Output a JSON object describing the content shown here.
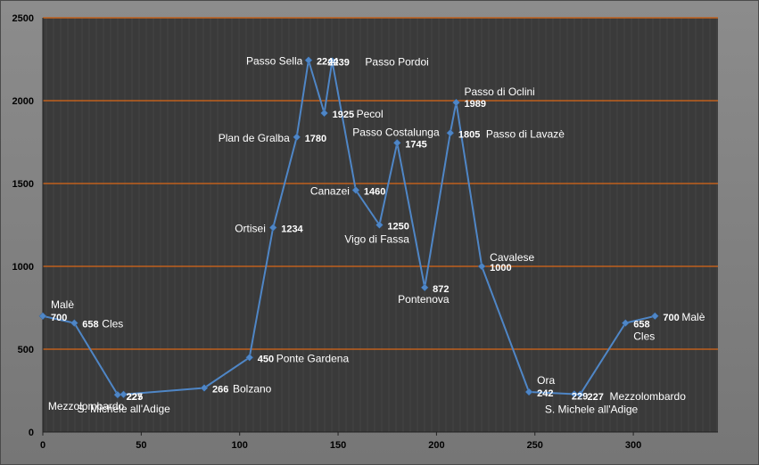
{
  "chart_data": {
    "type": "line",
    "title": "",
    "xlabel": "",
    "ylabel": "",
    "xlim": [
      0,
      343
    ],
    "ylim": [
      0,
      2500
    ],
    "x_ticks": [
      0,
      50,
      100,
      150,
      200,
      250,
      300
    ],
    "y_ticks": [
      0,
      500,
      1000,
      1500,
      2000,
      2500
    ],
    "grid": "horizontal",
    "legend": "none",
    "colors": {
      "background": "#3a3a3a",
      "gridline": "#c0601c",
      "series": "#4f86c6",
      "labels": "#ffffff"
    },
    "series": [
      {
        "points": [
          {
            "x": 0,
            "y": 700,
            "value": "700",
            "name": "Malè"
          },
          {
            "x": 16,
            "y": 658,
            "value": "658",
            "name": "Cles"
          },
          {
            "x": 38,
            "y": 225,
            "value": "225",
            "name": "Mezzolombardo"
          },
          {
            "x": 41,
            "y": 227,
            "value": "227",
            "name": "S. Michele all'Adige"
          },
          {
            "x": 82,
            "y": 266,
            "value": "266",
            "name": "Bolzano"
          },
          {
            "x": 105,
            "y": 450,
            "value": "450",
            "name": "Ponte Gardena"
          },
          {
            "x": 117,
            "y": 1234,
            "value": "1234",
            "name": "Ortisei"
          },
          {
            "x": 129,
            "y": 1780,
            "value": "1780",
            "name": "Plan de Gralba"
          },
          {
            "x": 135,
            "y": 2244,
            "value": "2244",
            "name": "Passo Sella"
          },
          {
            "x": 143,
            "y": 1925,
            "value": "1925",
            "name": "Pecol"
          },
          {
            "x": 147,
            "y": 2239,
            "value": "2239",
            "name": "Passo Pordoi"
          },
          {
            "x": 159,
            "y": 1460,
            "value": "1460",
            "name": "Canazei"
          },
          {
            "x": 171,
            "y": 1250,
            "value": "1250",
            "name": "Vigo di Fassa"
          },
          {
            "x": 180,
            "y": 1745,
            "value": "1745",
            "name": "Passo Costalunga"
          },
          {
            "x": 194,
            "y": 872,
            "value": "872",
            "name": "Pontenova"
          },
          {
            "x": 207,
            "y": 1805,
            "value": "1805",
            "name": "Passo di Lavazè"
          },
          {
            "x": 210,
            "y": 1989,
            "value": "1989",
            "name": "Passo di Oclini"
          },
          {
            "x": 223,
            "y": 1000,
            "value": "1000",
            "name": "Cavalese"
          },
          {
            "x": 247,
            "y": 242,
            "value": "242",
            "name": "Ora"
          },
          {
            "x": 270,
            "y": 229,
            "value": "229",
            "name": "S. Michele all'Adige"
          },
          {
            "x": 273,
            "y": 227,
            "value": "227",
            "name": "Mezzolombardo"
          },
          {
            "x": 296,
            "y": 658,
            "value": "658",
            "name": "Cles"
          },
          {
            "x": 311,
            "y": 700,
            "value": "700",
            "name": "Malè"
          }
        ]
      }
    ]
  }
}
